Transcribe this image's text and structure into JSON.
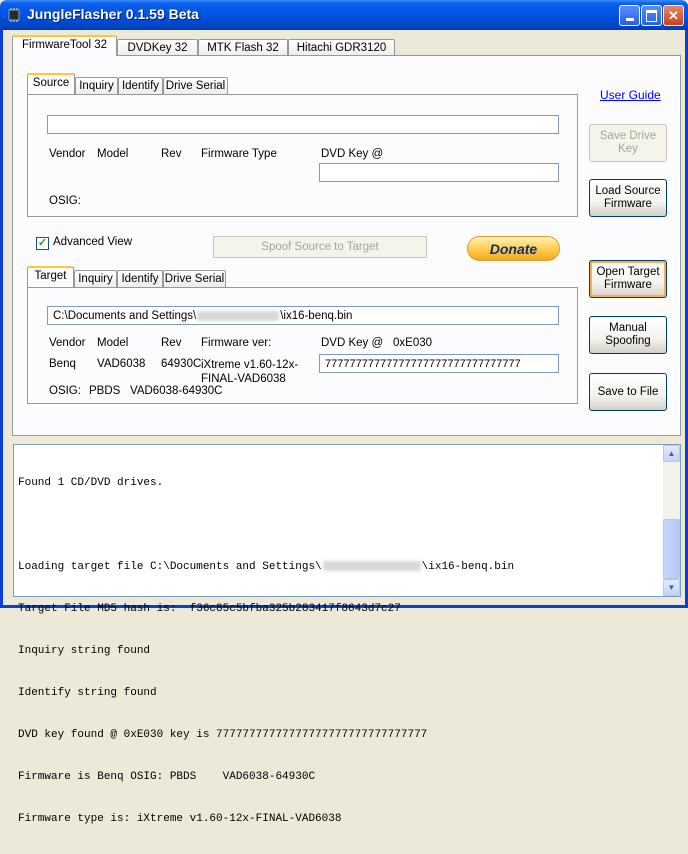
{
  "window": {
    "title": "JungleFlasher 0.1.59 Beta"
  },
  "main_tabs": [
    "FirmwareTool 32",
    "DVDKey 32",
    "MTK Flash 32",
    "Hitachi GDR3120"
  ],
  "source": {
    "tabs": [
      "Source",
      "Inquiry",
      "Identify",
      "Drive Serial"
    ],
    "path_value": "",
    "labels": {
      "vendor": "Vendor",
      "model": "Model",
      "rev": "Rev",
      "firmware_type": "Firmware Type",
      "dvd_key": "DVD Key @",
      "osig": "OSIG:"
    },
    "dvd_key_value": ""
  },
  "advanced_view": {
    "label": "Advanced View",
    "checked": true
  },
  "spoof_button": "Spoof Source to Target",
  "donate_button": "Donate",
  "target": {
    "tabs": [
      "Target",
      "Inquiry",
      "Identify",
      "Drive Serial"
    ],
    "path_prefix": "C:\\Documents and Settings\\",
    "path_suffix": "\\ix16-benq.bin",
    "labels": {
      "vendor": "Vendor",
      "model": "Model",
      "rev": "Rev",
      "firmware_ver": "Firmware ver:",
      "dvd_key": "DVD Key @",
      "dvd_key_offset": "0xE030",
      "osig": "OSIG:"
    },
    "values": {
      "vendor": "Benq",
      "model": "VAD6038",
      "rev": "64930C",
      "firmware_ver": "iXtreme v1.60-12x-FINAL-VAD6038",
      "osig_a": "PBDS",
      "osig_b": "VAD6038-64930C"
    },
    "dvd_key_value": "77777777777777777777777777777777"
  },
  "side_buttons": {
    "user_guide": "User Guide",
    "save_drive_key": "Save Drive Key",
    "load_source_firmware": "Load Source Firmware",
    "open_target_firmware": "Open Target Firmware",
    "manual_spoofing": "Manual Spoofing",
    "save_to_file": "Save to File"
  },
  "log": {
    "line1": "Found 1 CD/DVD drives.",
    "line2": "",
    "line3_prefix": "Loading target file C:\\Documents and Settings\\",
    "line3_suffix": "\\ix16-benq.bin",
    "line4": "Target File MD5 hash is:  f36c85c5bfba325b283417f8643d7c27",
    "line5": "Inquiry string found",
    "line6": "Identify string found",
    "line7": "DVD key found @ 0xE030 key is 77777777777777777777777777777777",
    "line8": "Firmware is Benq OSIG: PBDS    VAD6038-64930C",
    "line9": "Firmware type is: iXtreme v1.60-12x-FINAL-VAD6038"
  },
  "colors": {
    "titlebar": "#0054E3",
    "tab_highlight": "#FFC83C",
    "link": "#0000FF"
  }
}
